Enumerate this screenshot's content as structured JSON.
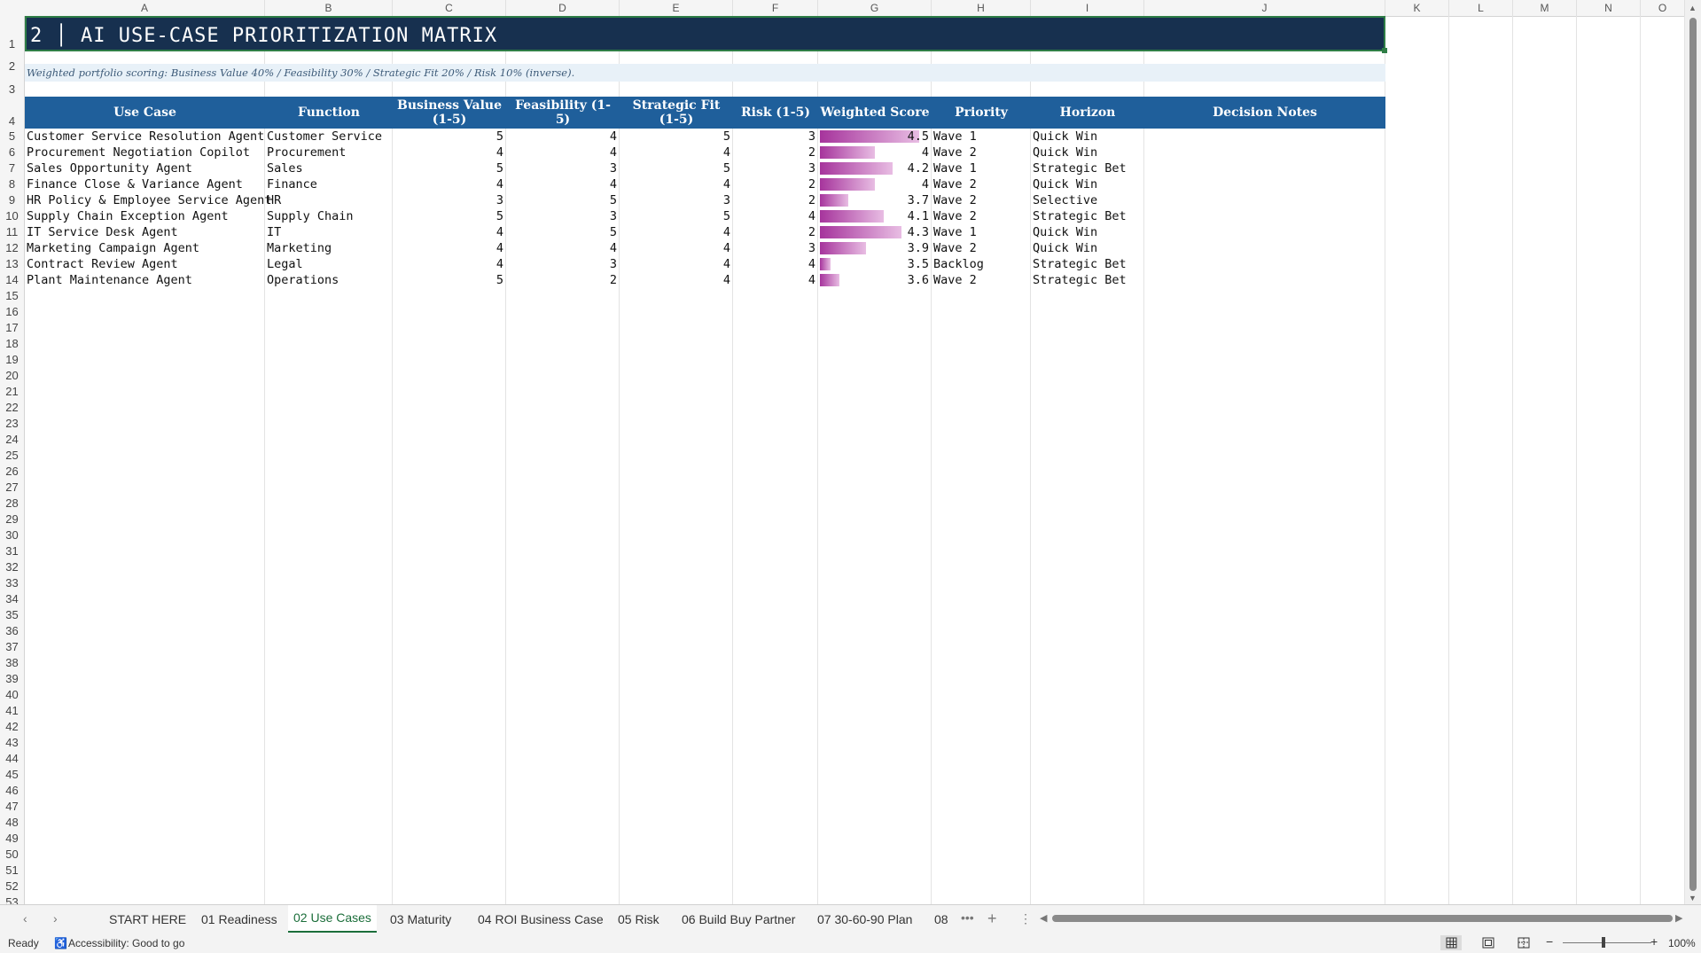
{
  "columns": [
    "A",
    "B",
    "C",
    "D",
    "E",
    "F",
    "G",
    "H",
    "I",
    "J",
    "K",
    "L",
    "M",
    "N",
    "O"
  ],
  "row_numbers": [
    "1",
    "2",
    "3",
    "4",
    "5",
    "6",
    "7",
    "8",
    "9",
    "10",
    "11",
    "12",
    "13",
    "14",
    "15",
    "16",
    "17",
    "18",
    "19",
    "20",
    "21",
    "22",
    "23",
    "24",
    "25",
    "26",
    "27",
    "28",
    "29",
    "30",
    "31",
    "32",
    "33",
    "34",
    "35",
    "36",
    "37",
    "38",
    "39",
    "40",
    "41",
    "42",
    "43",
    "44",
    "45",
    "46",
    "47",
    "48",
    "49",
    "50",
    "51",
    "52",
    "53"
  ],
  "sheet": {
    "title": "2 │ AI USE-CASE PRIORITIZATION MATRIX",
    "subtitle": "Weighted portfolio scoring: Business Value 40% / Feasibility 30% / Strategic Fit 20% / Risk 10% (inverse).",
    "headers": [
      "Use Case",
      "Function",
      "Business Value (1-5)",
      "Feasibility (1-5)",
      "Strategic Fit (1-5)",
      "Risk (1-5)",
      "Weighted Score",
      "Priority",
      "Horizon",
      "Decision Notes"
    ],
    "databar_range": [
      3.5,
      4.5
    ],
    "rows": [
      {
        "use_case": "Customer Service Resolution Agent",
        "function": "Customer Service",
        "bv": "5",
        "feas": "4",
        "fit": "5",
        "risk": "3",
        "score": "4.5",
        "score_value": 4.5,
        "priority": "Wave 1",
        "horizon": "Quick Win",
        "notes": ""
      },
      {
        "use_case": "Procurement Negotiation Copilot",
        "function": "Procurement",
        "bv": "4",
        "feas": "4",
        "fit": "4",
        "risk": "2",
        "score": "4",
        "score_value": 4.0,
        "priority": "Wave 2",
        "horizon": "Quick Win",
        "notes": ""
      },
      {
        "use_case": "Sales Opportunity Agent",
        "function": "Sales",
        "bv": "5",
        "feas": "3",
        "fit": "5",
        "risk": "3",
        "score": "4.2",
        "score_value": 4.2,
        "priority": "Wave 1",
        "horizon": "Strategic Bet",
        "notes": ""
      },
      {
        "use_case": "Finance Close & Variance Agent",
        "function": "Finance",
        "bv": "4",
        "feas": "4",
        "fit": "4",
        "risk": "2",
        "score": "4",
        "score_value": 4.0,
        "priority": "Wave 2",
        "horizon": "Quick Win",
        "notes": ""
      },
      {
        "use_case": "HR Policy & Employee Service Agent",
        "function": "HR",
        "bv": "3",
        "feas": "5",
        "fit": "3",
        "risk": "2",
        "score": "3.7",
        "score_value": 3.7,
        "priority": "Wave 2",
        "horizon": "Selective",
        "notes": ""
      },
      {
        "use_case": "Supply Chain Exception Agent",
        "function": "Supply Chain",
        "bv": "5",
        "feas": "3",
        "fit": "5",
        "risk": "4",
        "score": "4.1",
        "score_value": 4.1,
        "priority": "Wave 2",
        "horizon": "Strategic Bet",
        "notes": ""
      },
      {
        "use_case": "IT Service Desk Agent",
        "function": "IT",
        "bv": "4",
        "feas": "5",
        "fit": "4",
        "risk": "2",
        "score": "4.3",
        "score_value": 4.3,
        "priority": "Wave 1",
        "horizon": "Quick Win",
        "notes": ""
      },
      {
        "use_case": "Marketing Campaign Agent",
        "function": "Marketing",
        "bv": "4",
        "feas": "4",
        "fit": "4",
        "risk": "3",
        "score": "3.9",
        "score_value": 3.9,
        "priority": "Wave 2",
        "horizon": "Quick Win",
        "notes": ""
      },
      {
        "use_case": "Contract Review Agent",
        "function": "Legal",
        "bv": "4",
        "feas": "3",
        "fit": "4",
        "risk": "4",
        "score": "3.5",
        "score_value": 3.5,
        "priority": "Backlog",
        "horizon": "Strategic Bet",
        "notes": ""
      },
      {
        "use_case": "Plant Maintenance Agent",
        "function": "Operations",
        "bv": "5",
        "feas": "2",
        "fit": "4",
        "risk": "4",
        "score": "3.6",
        "score_value": 3.6,
        "priority": "Wave 2",
        "horizon": "Strategic Bet",
        "notes": ""
      }
    ]
  },
  "tabs": [
    "START HERE",
    "01 Readiness",
    "02 Use Cases",
    "03 Maturity",
    "04 ROI Business Case",
    "05 Risk",
    "06 Build Buy Partner",
    "07 30-60-90 Plan",
    "08"
  ],
  "active_tab": "02 Use Cases",
  "tab_controls": {
    "more": "•••",
    "add": "+",
    "options": "⋮",
    "prev": "‹",
    "next": "›"
  },
  "status": {
    "ready": "Ready",
    "accessibility": "Accessibility: Good to go",
    "zoom": "100%",
    "zoom_minus": "−",
    "zoom_plus": "+"
  },
  "colors": {
    "title_bg": "#17304f",
    "header_bg": "#1f5f9b",
    "subtitle_bg": "#e8f1f8",
    "databar": "#a6349c",
    "active_tab": "#1b6e3a"
  }
}
